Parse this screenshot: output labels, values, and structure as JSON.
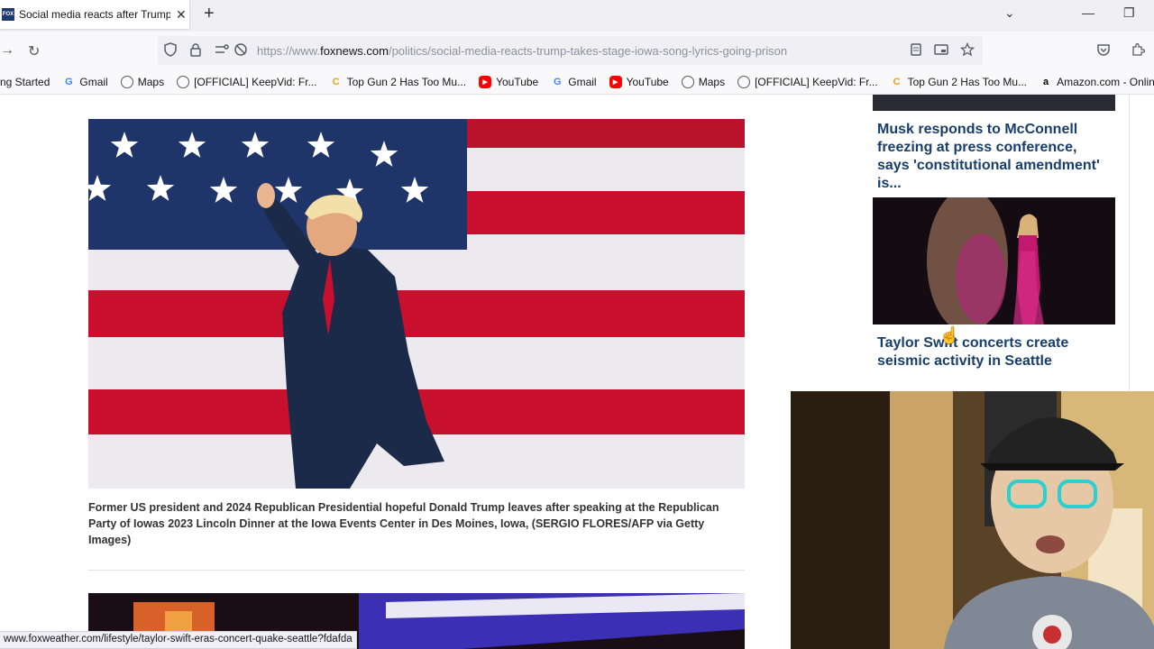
{
  "tab": {
    "favicon": "FOX",
    "title": "Social media reacts after Trump",
    "close": "✕"
  },
  "browser": {
    "new_tab": "+"
  },
  "url": {
    "prefix": "https://www.",
    "host": "foxnews.com",
    "path": "/politics/social-media-reacts-trump-takes-stage-iowa-song-lyrics-going-prison"
  },
  "bookmarks": [
    {
      "label": "ng Started",
      "icon": "none"
    },
    {
      "label": "Gmail",
      "icon": "google-icon"
    },
    {
      "label": "Maps",
      "icon": "globe-icon"
    },
    {
      "label": "[OFFICIAL] KeepVid: Fr...",
      "icon": "globe-icon"
    },
    {
      "label": "Top Gun 2 Has Too Mu...",
      "icon": "c-icon"
    },
    {
      "label": "YouTube",
      "icon": "youtube-icon"
    },
    {
      "label": "Gmail",
      "icon": "google-icon"
    },
    {
      "label": "YouTube",
      "icon": "youtube-icon"
    },
    {
      "label": "Maps",
      "icon": "globe-icon"
    },
    {
      "label": "[OFFICIAL] KeepVid: Fr...",
      "icon": "globe-icon"
    },
    {
      "label": "Top Gun 2 Has Too Mu...",
      "icon": "c-icon"
    },
    {
      "label": "Amazon.com - Online...",
      "icon": "amazon-icon"
    }
  ],
  "article": {
    "caption": "Former US president and 2024 Republican Presidential hopeful Donald Trump leaves after speaking at the Republican Party of Iowas 2023 Lincoln Dinner at the Iowa Events Center in Des Moines, Iowa,  (SERGIO FLORES/AFP via Getty Images)"
  },
  "sidebar": {
    "items": [
      {
        "headline": "Musk responds to McConnell freezing at press conference, says 'constitutional amendment' is..."
      },
      {
        "headline": "Taylor Swift concerts create seismic activity in Seattle"
      }
    ]
  },
  "status": {
    "url": "www.foxweather.com/lifestyle/taylor-swift-eras-concert-quake-seattle?fdafda"
  },
  "colors": {
    "headline": "#183e6b",
    "flag_red": "#c8102e",
    "flag_blue": "#1f3569"
  }
}
